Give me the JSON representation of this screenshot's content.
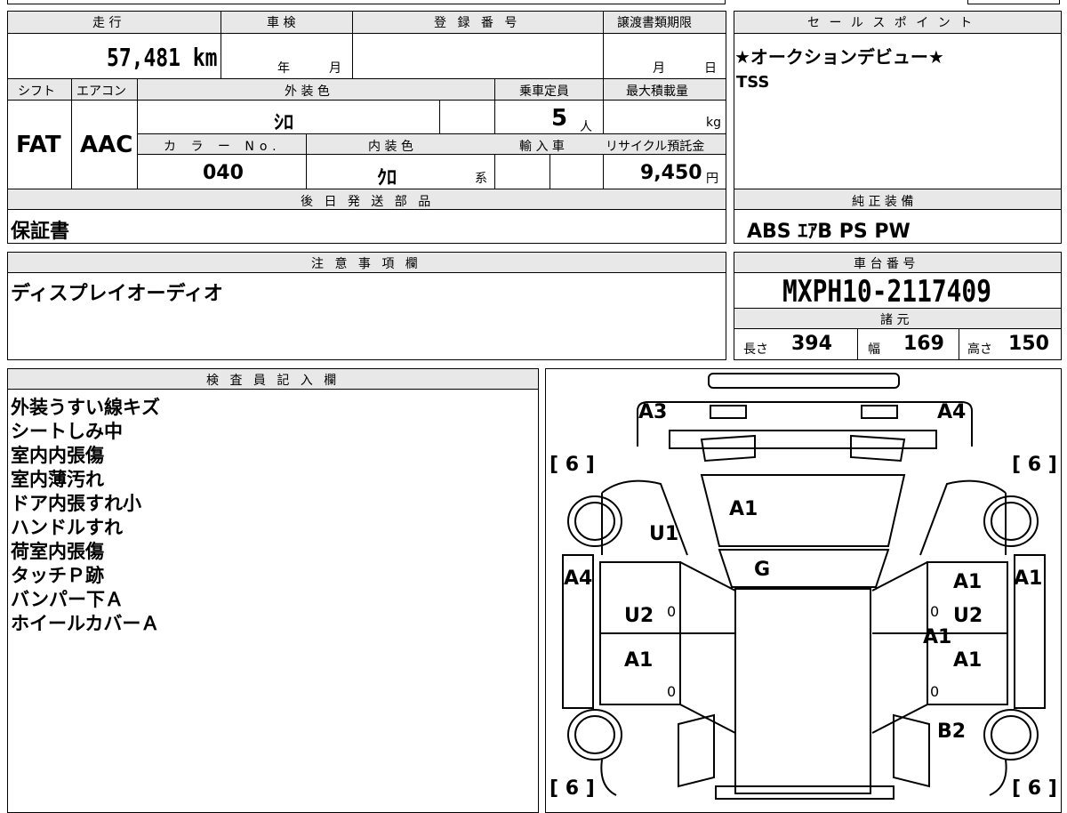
{
  "header": {
    "mileage_label": "走 行",
    "inspection_label": "車 検",
    "registration_label": "登 録 番 号",
    "transfer_deadline_label": "譲渡書類期限",
    "sales_point_label": "セ ー ル ス ポ イ ン ト"
  },
  "mileage": "57,481 km",
  "inspection_year_unit": "年",
  "inspection_month_unit": "月",
  "transfer_month_unit": "月",
  "transfer_day_unit": "日",
  "labels": {
    "shift": "シフト",
    "aircon": "エアコン",
    "exterior_color": "外 装 色",
    "capacity": "乗車定員",
    "max_load": "最大積載量",
    "color_no": "カ ラ ー No.",
    "interior_color": "内 装 色",
    "import": "輸 入 車",
    "recycle": "リサイクル預託金",
    "later_parts": "後 日 発 送 部 品",
    "standard_equipment": "純 正 装 備",
    "notes": "注 意 事 項 欄",
    "chassis_no": "車 台 番 号",
    "specs": "諸 元",
    "inspector": "検 査 員 記 入 欄"
  },
  "shift": "FAT",
  "aircon": "AAC",
  "exterior_color": "ｼﾛ",
  "capacity": "5",
  "capacity_unit": "人",
  "max_load_unit": "kg",
  "color_no": "040",
  "interior_color": "ｸﾛ",
  "interior_color_unit": "系",
  "recycle_fee": "9,450",
  "recycle_unit": "円",
  "sales_points": [
    "★オークションデビュー★",
    "TSS"
  ],
  "later_parts": "保証書",
  "standard_equipment": "ABS ｴｱB PS PW",
  "notes": "ディスプレイオーディオ",
  "chassis_no": "MXPH10-2117409",
  "specs": {
    "length_label": "長さ",
    "length": "394",
    "width_label": "幅",
    "width": "169",
    "height_label": "高さ",
    "height": "150"
  },
  "inspector_remarks": [
    "外装うすい線キズ",
    "シートしみ中",
    "室内内張傷",
    "室内薄汚れ",
    "ドア内張すれ小",
    "ハンドルすれ",
    "荷室内張傷",
    "タッチＰ跡",
    "バンパー下Ａ",
    "ホイールカバーＡ"
  ],
  "diagram": {
    "a3": "A3",
    "a4_top": "A4",
    "tire_fl": "6",
    "tire_fr": "6",
    "tire_rl": "6",
    "tire_rr": "6",
    "hood": "A1",
    "u1": "U1",
    "g": "G",
    "left_front_fender": "A4",
    "left_front_door": "U2",
    "left_rear_door": "A1",
    "right_front_door_1": "A1",
    "right_front_door_2": "U2",
    "right_center": "A1",
    "right_rear_door": "A1",
    "right_fender": "A1",
    "right_rear": "B2",
    "zero_l1": "0",
    "zero_l2": "0",
    "zero_r1": "0",
    "zero_r2": "0"
  }
}
